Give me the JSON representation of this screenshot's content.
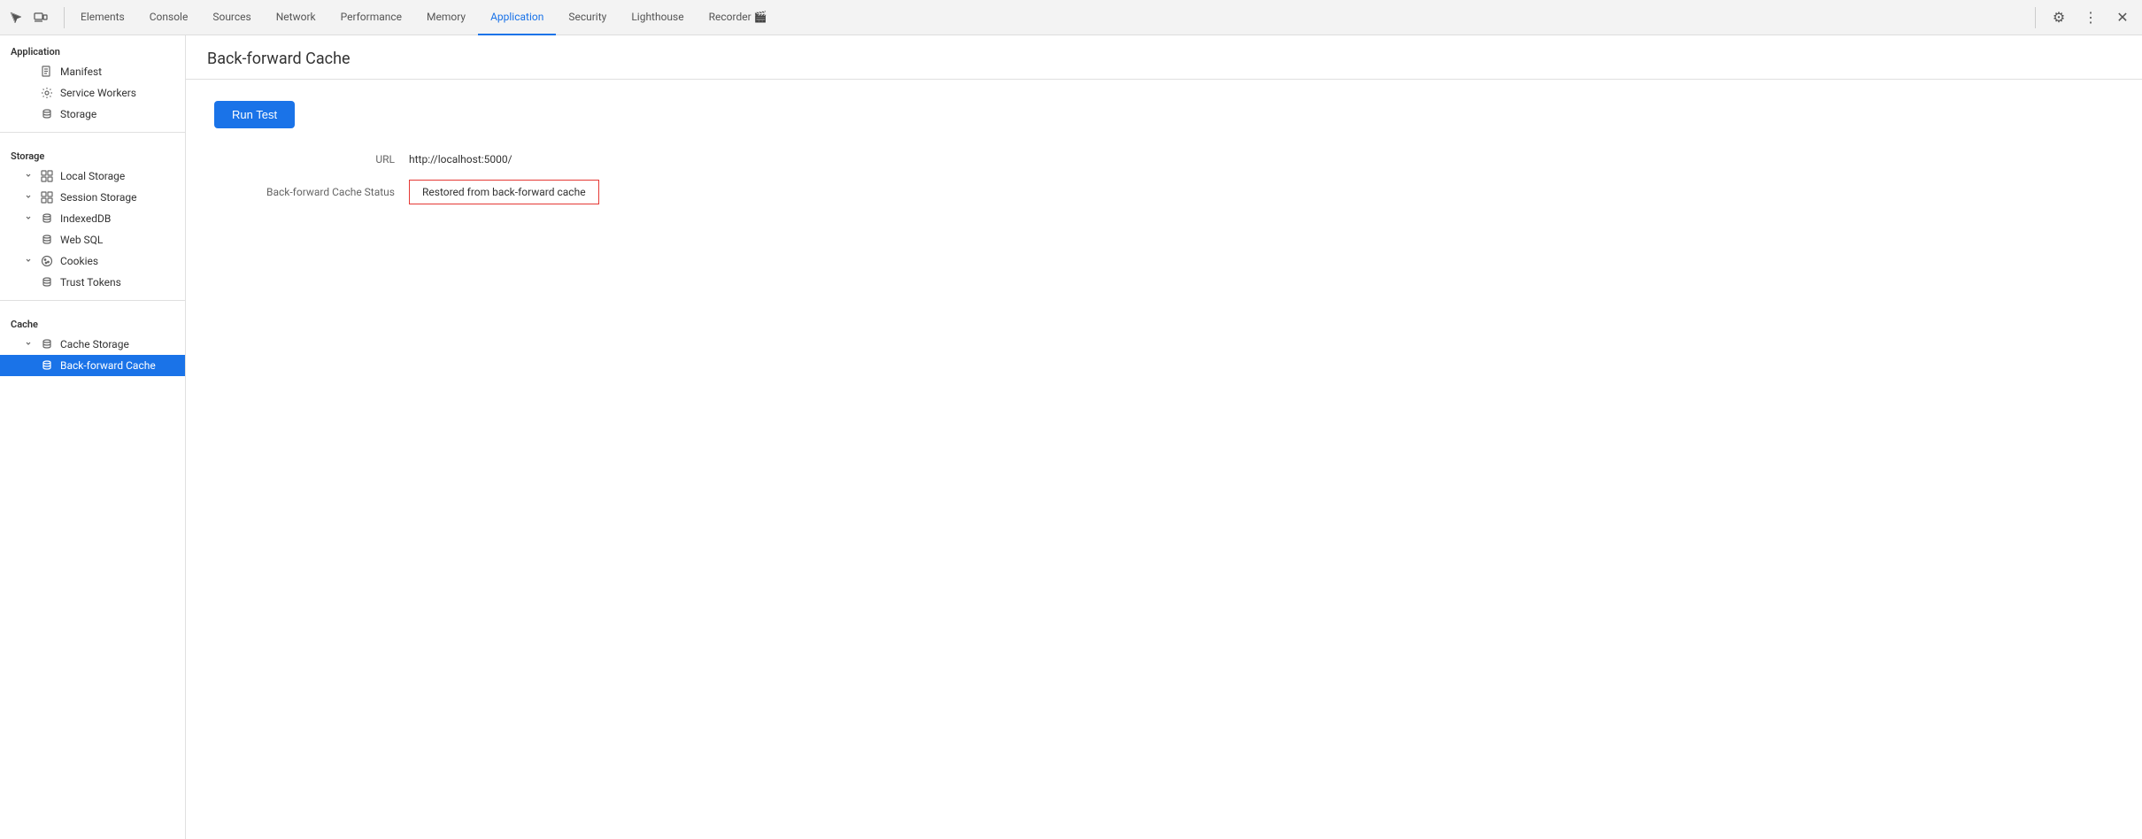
{
  "tabs": [
    {
      "id": "elements",
      "label": "Elements",
      "active": false
    },
    {
      "id": "console",
      "label": "Console",
      "active": false
    },
    {
      "id": "sources",
      "label": "Sources",
      "active": false
    },
    {
      "id": "network",
      "label": "Network",
      "active": false
    },
    {
      "id": "performance",
      "label": "Performance",
      "active": false
    },
    {
      "id": "memory",
      "label": "Memory",
      "active": false
    },
    {
      "id": "application",
      "label": "Application",
      "active": true
    },
    {
      "id": "security",
      "label": "Security",
      "active": false
    },
    {
      "id": "lighthouse",
      "label": "Lighthouse",
      "active": false
    },
    {
      "id": "recorder",
      "label": "Recorder 🎬",
      "active": false
    }
  ],
  "sidebar": {
    "sections": [
      {
        "label": "Application",
        "items": [
          {
            "id": "manifest",
            "label": "Manifest",
            "icon": "file",
            "active": false,
            "indented": 1
          },
          {
            "id": "service-workers",
            "label": "Service Workers",
            "icon": "gear",
            "active": false,
            "indented": 1
          },
          {
            "id": "storage",
            "label": "Storage",
            "icon": "db",
            "active": false,
            "indented": 1
          }
        ]
      },
      {
        "label": "Storage",
        "items": [
          {
            "id": "local-storage",
            "label": "Local Storage",
            "icon": "grid",
            "active": false,
            "indented": 1,
            "expandable": true
          },
          {
            "id": "session-storage",
            "label": "Session Storage",
            "icon": "grid",
            "active": false,
            "indented": 1,
            "expandable": true
          },
          {
            "id": "indexeddb",
            "label": "IndexedDB",
            "icon": "db",
            "active": false,
            "indented": 1,
            "expandable": true
          },
          {
            "id": "web-sql",
            "label": "Web SQL",
            "icon": "db",
            "active": false,
            "indented": 1,
            "expandable": false
          },
          {
            "id": "cookies",
            "label": "Cookies",
            "icon": "cookie",
            "active": false,
            "indented": 1,
            "expandable": true
          },
          {
            "id": "trust-tokens",
            "label": "Trust Tokens",
            "icon": "db",
            "active": false,
            "indented": 1,
            "expandable": false
          }
        ]
      },
      {
        "label": "Cache",
        "items": [
          {
            "id": "cache-storage",
            "label": "Cache Storage",
            "icon": "db",
            "active": false,
            "indented": 1,
            "expandable": true
          },
          {
            "id": "back-forward-cache",
            "label": "Back-forward Cache",
            "icon": "db",
            "active": true,
            "indented": 1,
            "expandable": false
          }
        ]
      }
    ]
  },
  "content": {
    "title": "Back-forward Cache",
    "run_test_label": "Run Test",
    "url_label": "URL",
    "url_value": "http://localhost:5000/",
    "status_label": "Back-forward Cache Status",
    "status_value": "Restored from back-forward cache"
  }
}
